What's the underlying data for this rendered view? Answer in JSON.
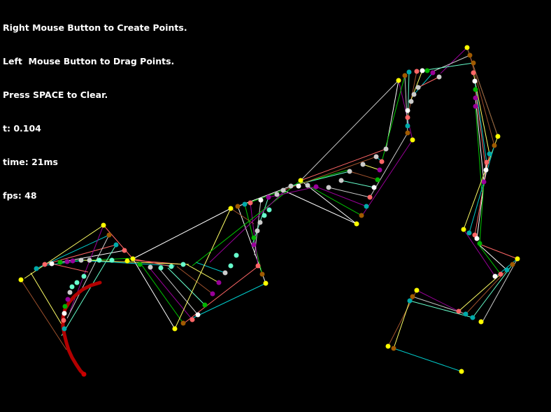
{
  "hud": {
    "instruction_create": "Right Mouse Button to Create Points.",
    "instruction_drag": "Left  Mouse Button to Drag Points.",
    "instruction_clear": "Press SPACE to Clear.",
    "t_label": "t: 0.104",
    "time_label": "time: 21ms",
    "fps_label": "fps: 48"
  },
  "scene": {
    "t": 0.104,
    "background": "#000000",
    "hull_colors": [
      "#ffff66",
      "#00cccc",
      "#ff6666",
      "#ffffff",
      "#00cc00",
      "#990099",
      "#cccccc",
      "#66ffcc",
      "#a0522d"
    ],
    "curve_color": "#b30000",
    "point_colors": [
      "#ffff00",
      "#a05a00",
      "#00aaaa",
      "#ff6666",
      "#ffffff",
      "#00b300",
      "#990099",
      "#cccccc",
      "#66ffcc"
    ]
  }
}
